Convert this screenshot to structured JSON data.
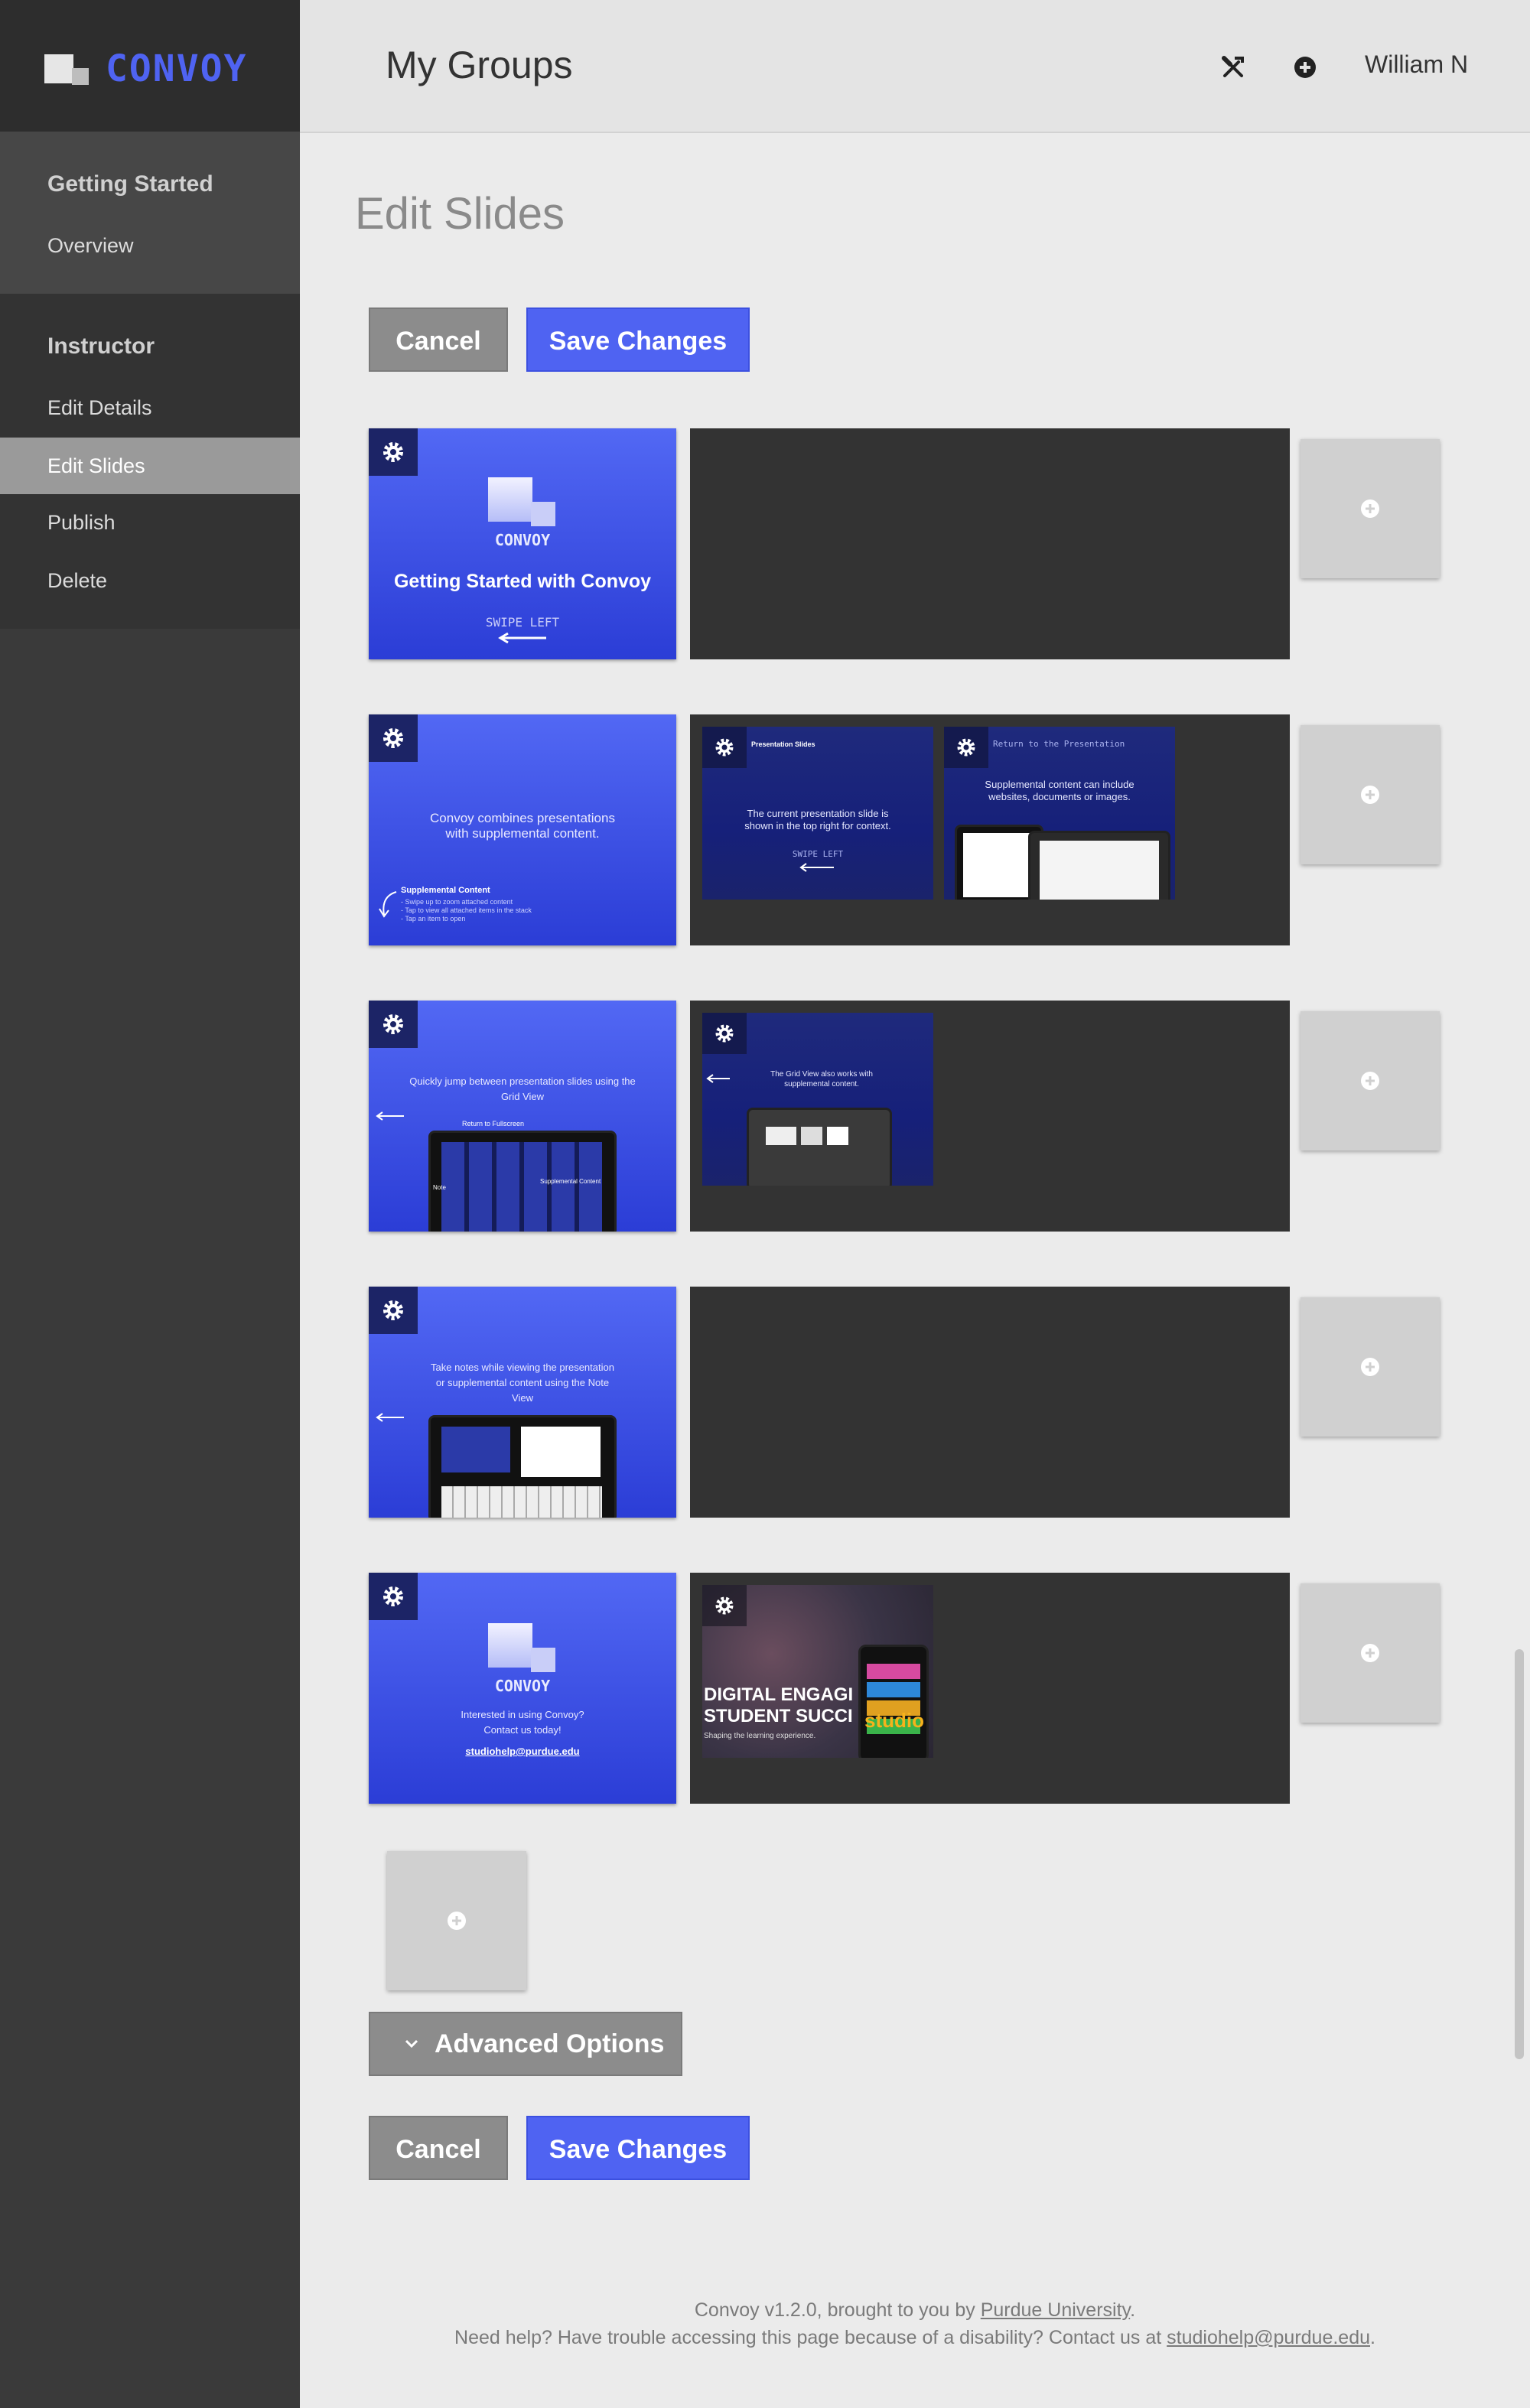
{
  "app": {
    "name": "CONVOY",
    "brand_color": "#4f63f2"
  },
  "topbar": {
    "page_title": "My Groups",
    "user": "William N",
    "icons": [
      "tools-icon",
      "add-circle-icon"
    ]
  },
  "sidebar": {
    "sections": [
      {
        "heading": "Getting Started",
        "items": [
          {
            "label": "Overview"
          }
        ]
      },
      {
        "heading": "Instructor",
        "items": [
          {
            "label": "Edit Details"
          },
          {
            "label": "Edit Slides",
            "active": true
          },
          {
            "label": "Publish"
          },
          {
            "label": "Delete"
          }
        ]
      }
    ]
  },
  "main": {
    "title": "Edit Slides",
    "cancel_label": "Cancel",
    "save_label": "Save Changes",
    "advanced_label": "Advanced Options",
    "slides": [
      {
        "caption": "Getting Started with Convoy",
        "logo_text": "CONVOY",
        "swipe": "SWIPE LEFT"
      },
      {
        "caption": "Convoy combines presentations with supplemental content.",
        "note_title": "Supplemental Content",
        "note_lines": [
          "- Swipe up to zoom attached content",
          "- Tap to view all attached items in the stack",
          "- Tap an item to open"
        ],
        "supplements": [
          {
            "title": "Presentation Slides",
            "text": "The current presentation slide is shown in the top right for context.",
            "swipe": "SWIPE LEFT"
          },
          {
            "title": "Return to the Presentation",
            "text": "Supplemental content can include websites, documents or images."
          }
        ]
      },
      {
        "caption": "Quickly jump between presentation slides using the Grid View",
        "labels": [
          "Return to Fullscreen",
          "Supplemental Content",
          "Note"
        ],
        "supplements": [
          {
            "text": "The Grid View also works with supplemental content."
          }
        ]
      },
      {
        "caption": "Take notes while viewing the presentation or supplemental content using the Note View"
      },
      {
        "logo_text": "CONVOY",
        "caption": "Interested in using Convoy? Contact us today!",
        "email": "studiohelp@purdue.edu",
        "supplements": [
          {
            "headline1": "DIGITAL ENGAGI",
            "headline2": "STUDENT SUCCI",
            "tagline": "Shaping the learning experience.",
            "badge": "studio"
          }
        ]
      }
    ]
  },
  "footer": {
    "line1_prefix": "Convoy v1.2.0, brought to you by",
    "line1_link": "Purdue University",
    "line1_suffix": ".",
    "line2_prefix": "Need help? Have trouble accessing this page because of a disability? Contact us at",
    "line2_link": "studiohelp@purdue.edu",
    "line2_suffix": "."
  }
}
